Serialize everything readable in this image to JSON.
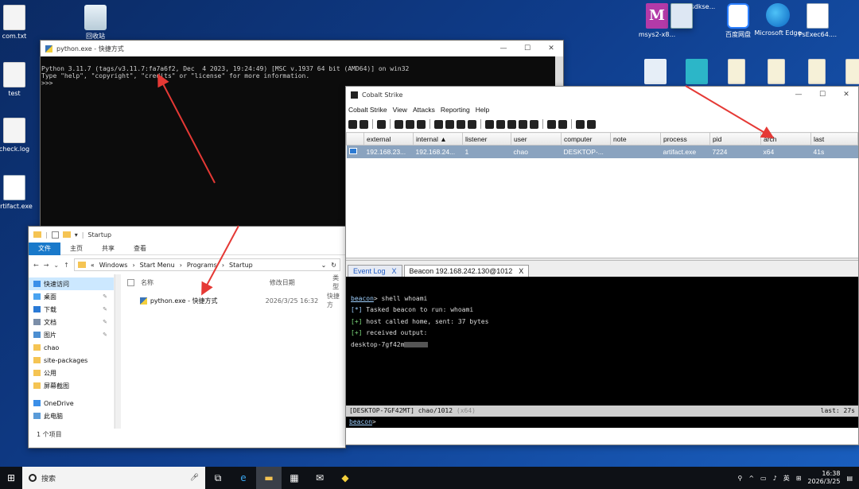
{
  "desktop": {
    "icons_left": [
      {
        "label": "com.txt",
        "icon": "document-icon"
      },
      {
        "label": "回收站",
        "icon": "recycle-bin-icon"
      },
      {
        "label": "test",
        "icon": "shortcut-icon"
      },
      {
        "label": "check.log",
        "icon": "document-icon"
      },
      {
        "label": "artifact.exe",
        "icon": "exe-icon"
      }
    ],
    "icons_right": [
      {
        "label": "msys2-x8...",
        "icon": "msys2-icon"
      },
      {
        "label": "winsdkse...",
        "icon": "installer-icon"
      },
      {
        "label": "百度网盘",
        "icon": "baidu-netdisk-icon"
      },
      {
        "label": "Microsoft Edge",
        "icon": "edge-icon"
      },
      {
        "label": "PsExec64....",
        "icon": "exe-icon"
      }
    ]
  },
  "python_window": {
    "title": "python.exe - 快捷方式",
    "lines": [
      "Python 3.11.7 (tags/v3.11.7:fa7a6f2, Dec  4 2023, 19:24:49) [MSC v.1937 64 bit (AMD64)] on win32",
      "Type \"help\", \"copyright\", \"credits\" or \"license\" for more information.",
      ">>>"
    ]
  },
  "explorer": {
    "title": "Startup",
    "ribbon_tabs": [
      "文件",
      "主页",
      "共享",
      "查看"
    ],
    "breadcrumb": [
      "Windows",
      "Start Menu",
      "Programs",
      "Startup"
    ],
    "nav_items": [
      {
        "label": "快速访问",
        "pinned": false,
        "color": "#3b8fe8"
      },
      {
        "label": "桌面",
        "pinned": true,
        "color": "#4aa3f0"
      },
      {
        "label": "下载",
        "pinned": true,
        "color": "#2a7ad6"
      },
      {
        "label": "文档",
        "pinned": true,
        "color": "#7b8ea8"
      },
      {
        "label": "图片",
        "pinned": true,
        "color": "#4d8fd1"
      },
      {
        "label": "chao",
        "pinned": false,
        "color": "#f5c453"
      },
      {
        "label": "site-packages",
        "pinned": false,
        "color": "#f5c453"
      },
      {
        "label": "公用",
        "pinned": false,
        "color": "#f5c453"
      },
      {
        "label": "屏幕截图",
        "pinned": false,
        "color": "#f5c453"
      },
      {
        "label": "OneDrive",
        "pinned": false,
        "color": "#3b8fe8"
      },
      {
        "label": "此电脑",
        "pinned": false,
        "color": "#5a9bd8"
      }
    ],
    "columns": [
      "名称",
      "修改日期",
      "类型"
    ],
    "files": [
      {
        "name": "python.exe - 快捷方式",
        "modified": "2026/3/25 16:32",
        "type": "快捷方"
      }
    ],
    "status": "1 个项目"
  },
  "cobalt_strike": {
    "title": "Cobalt Strike",
    "menu": [
      "Cobalt Strike",
      "View",
      "Attacks",
      "Reporting",
      "Help"
    ],
    "columns": [
      "external",
      "internal ▲",
      "listener",
      "user",
      "computer",
      "note",
      "process",
      "pid",
      "arch",
      "last"
    ],
    "beacons": [
      {
        "external": "192.168.23...",
        "internal": "192.168.24...",
        "listener": "1",
        "user": "chao",
        "computer": "DESKTOP-...",
        "note": "",
        "process": "artifact.exe",
        "pid": "7224",
        "arch": "x64",
        "last": "41s"
      }
    ],
    "tabs": [
      {
        "label": "Event Log",
        "close": "X"
      },
      {
        "label": "Beacon 192.168.242.130@1012",
        "close": "X"
      }
    ],
    "console": {
      "prompt": "beacon",
      "command": "> shell whoami",
      "lines": [
        {
          "tag": "[*]",
          "text": " Tasked beacon to run: whoami"
        },
        {
          "tag": "[+]",
          "text": " host called home, sent: 37 bytes"
        },
        {
          "tag": "[+]",
          "text": " received output:"
        }
      ],
      "output": "desktop-7gf42m"
    },
    "statusbar": {
      "left": "[DESKTOP-7GF42MT] chao/1012",
      "arch": "(x64)",
      "right": "last: 27s"
    },
    "input_prompt": "beacon",
    "input_suffix": ">"
  },
  "taskbar": {
    "search_placeholder": "搜索",
    "time": "16:38",
    "date": "2026/3/25",
    "ime": "英"
  }
}
